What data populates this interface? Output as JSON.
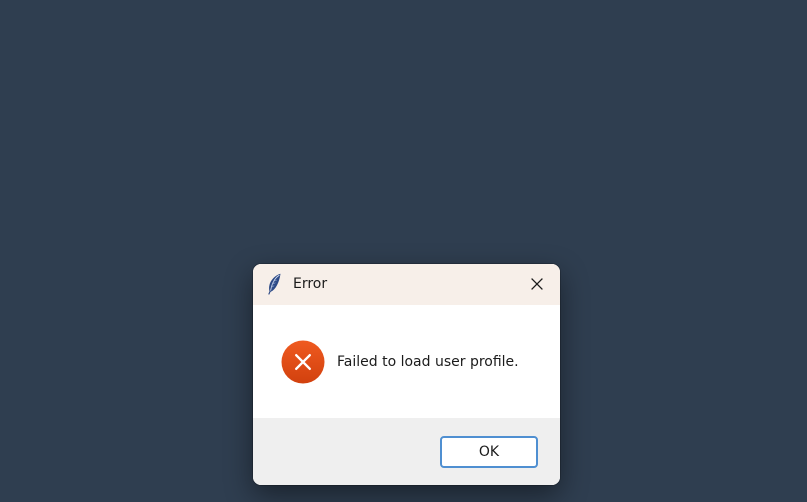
{
  "desktop": {
    "background_color": "#2f3e50"
  },
  "dialog": {
    "title": "Error",
    "title_icon": "feather-icon",
    "close_icon": "close-icon",
    "message": "Failed to load user profile.",
    "status_icon": "error-icon",
    "status_color": "#e24c17",
    "ok_label": "OK",
    "accent_color": "#4f8fd1"
  }
}
